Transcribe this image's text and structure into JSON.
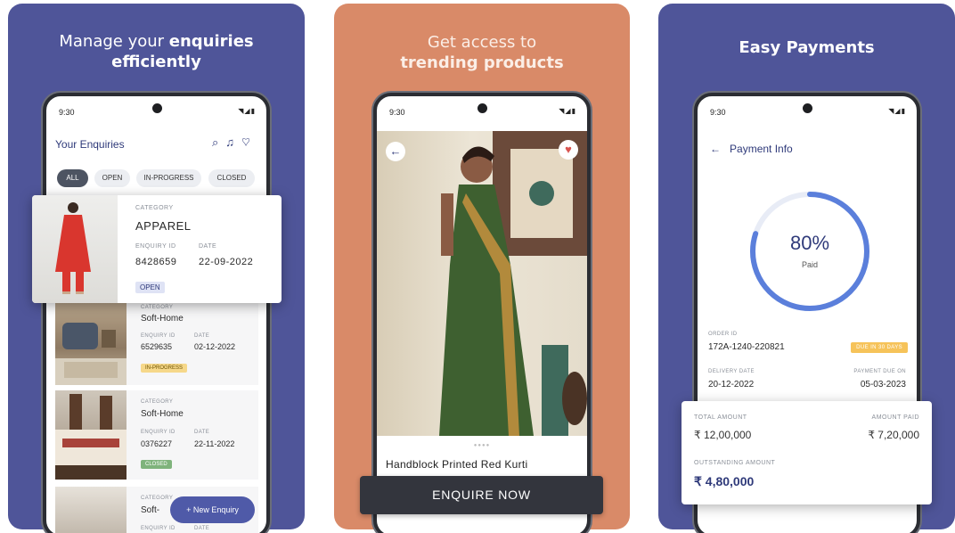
{
  "panels": [
    {
      "headline_plain": "Manage your ",
      "headline_bold": "enquiries",
      "headline_line2": "efficiently"
    },
    {
      "headline_line1": "Get access to",
      "headline_bold": "trending products"
    },
    {
      "headline_bold": "Easy Payments"
    }
  ],
  "status_bar": {
    "time": "9:30",
    "icons": "◥◢▮"
  },
  "enquiries": {
    "title": "Your Enquiries",
    "toolbar_icons": [
      "search-icon",
      "bell-icon",
      "heart-icon"
    ],
    "filters": [
      "ALL",
      "OPEN",
      "IN-PROGRESS",
      "CLOSED"
    ],
    "active_filter": "ALL",
    "labels": {
      "category": "CATEGORY",
      "enquiry_id": "ENQUIRY ID",
      "date": "DATE"
    },
    "highlight": {
      "category": "APPAREL",
      "enquiry_id": "8428659",
      "date": "22-09-2022",
      "status": "OPEN"
    },
    "items": [
      {
        "category": "Soft-Home",
        "enquiry_id": "6529635",
        "date": "02-12-2022",
        "status": "IN-PROGRESS"
      },
      {
        "category": "Soft-Home",
        "enquiry_id": "0376227",
        "date": "22-11-2022",
        "status": "CLOSED"
      },
      {
        "category": "Soft-",
        "enquiry_id": "",
        "date": "",
        "status": ""
      }
    ],
    "new_enquiry_label": "+ New Enquiry"
  },
  "product": {
    "title": "Handblock Printed Red Kurti",
    "cta": "ENQUIRE NOW",
    "dots": "●●●●",
    "back_icon": "←",
    "fav_icon": "♥"
  },
  "payment": {
    "header": "Payment Info",
    "back_icon": "←",
    "progress_percent": 80,
    "progress_label": "80%",
    "progress_caption": "Paid",
    "order_id_label": "ORDER ID",
    "order_id": "172A-1240-220821",
    "due_badge": "DUE IN 30 DAYS",
    "delivery_date_label": "DELIVERY DATE",
    "delivery_date": "20-12-2022",
    "payment_due_label": "PAYMENT DUE ON",
    "payment_due": "05-03-2023",
    "total_amount_label": "TOTAL AMOUNT",
    "total_amount": "₹ 12,00,000",
    "amount_paid_label": "AMOUNT PAID",
    "amount_paid": "₹ 7,20,000",
    "outstanding_label": "OUTSTANDING AMOUNT",
    "outstanding": "₹ 4,80,000"
  },
  "colors": {
    "panel_blue": "#4f5599",
    "panel_orange": "#d98a68",
    "accent": "#2f3a7a",
    "ring": "#5b7fdb"
  }
}
